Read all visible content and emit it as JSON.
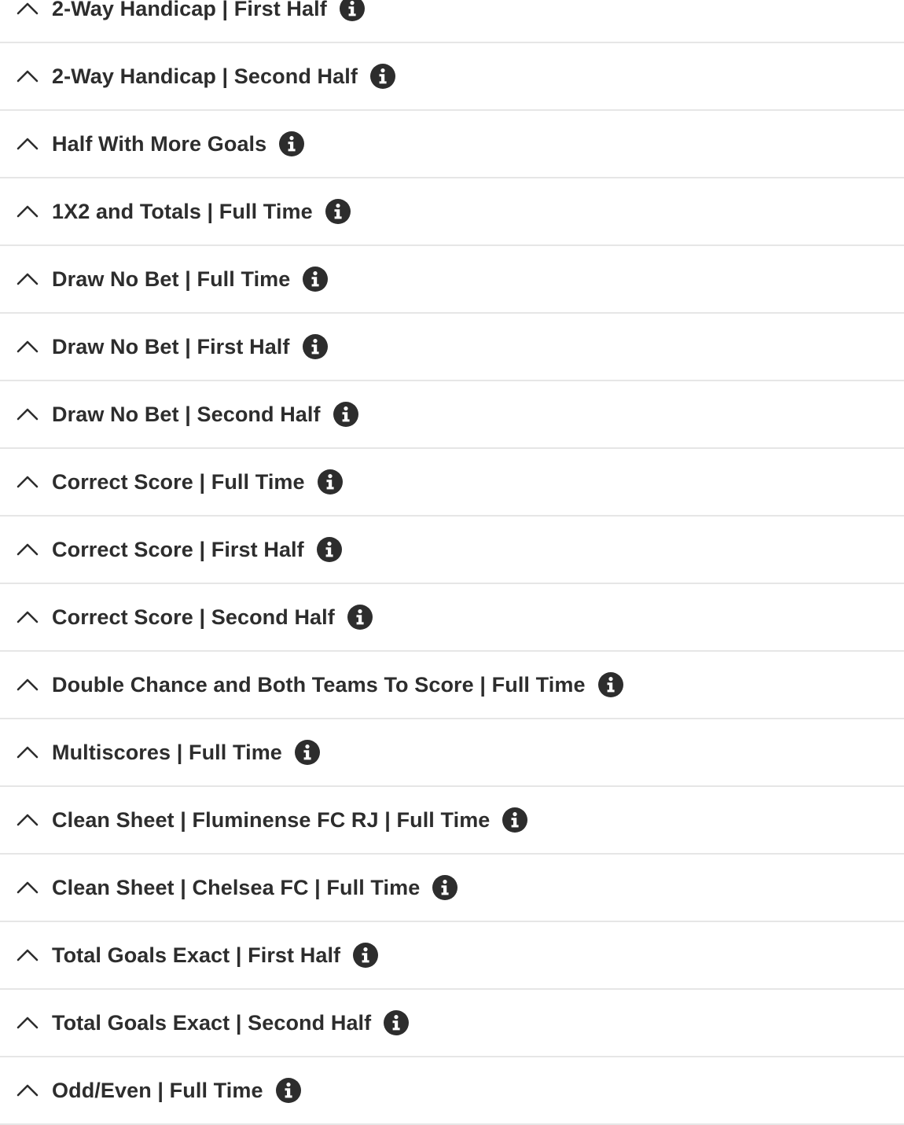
{
  "markets": [
    {
      "title": "2-Way Handicap | First Half"
    },
    {
      "title": "2-Way Handicap | Second Half"
    },
    {
      "title": "Half With More Goals"
    },
    {
      "title": "1X2 and Totals | Full Time"
    },
    {
      "title": "Draw No Bet | Full Time"
    },
    {
      "title": "Draw No Bet | First Half"
    },
    {
      "title": "Draw No Bet | Second Half"
    },
    {
      "title": "Correct Score | Full Time"
    },
    {
      "title": "Correct Score | First Half"
    },
    {
      "title": "Correct Score | Second Half"
    },
    {
      "title": "Double Chance and Both Teams To Score | Full Time"
    },
    {
      "title": "Multiscores | Full Time"
    },
    {
      "title": "Clean Sheet | Fluminense FC RJ | Full Time"
    },
    {
      "title": "Clean Sheet | Chelsea FC | Full Time"
    },
    {
      "title": "Total Goals Exact | First Half"
    },
    {
      "title": "Total Goals Exact | Second Half"
    },
    {
      "title": "Odd/Even | Full Time"
    }
  ],
  "icons": {
    "collapse": "chevron-up-icon",
    "info": "info-icon"
  },
  "colors": {
    "text": "#2d2d2d",
    "divider": "#e6e6e6",
    "icon": "#2d2d2d"
  }
}
